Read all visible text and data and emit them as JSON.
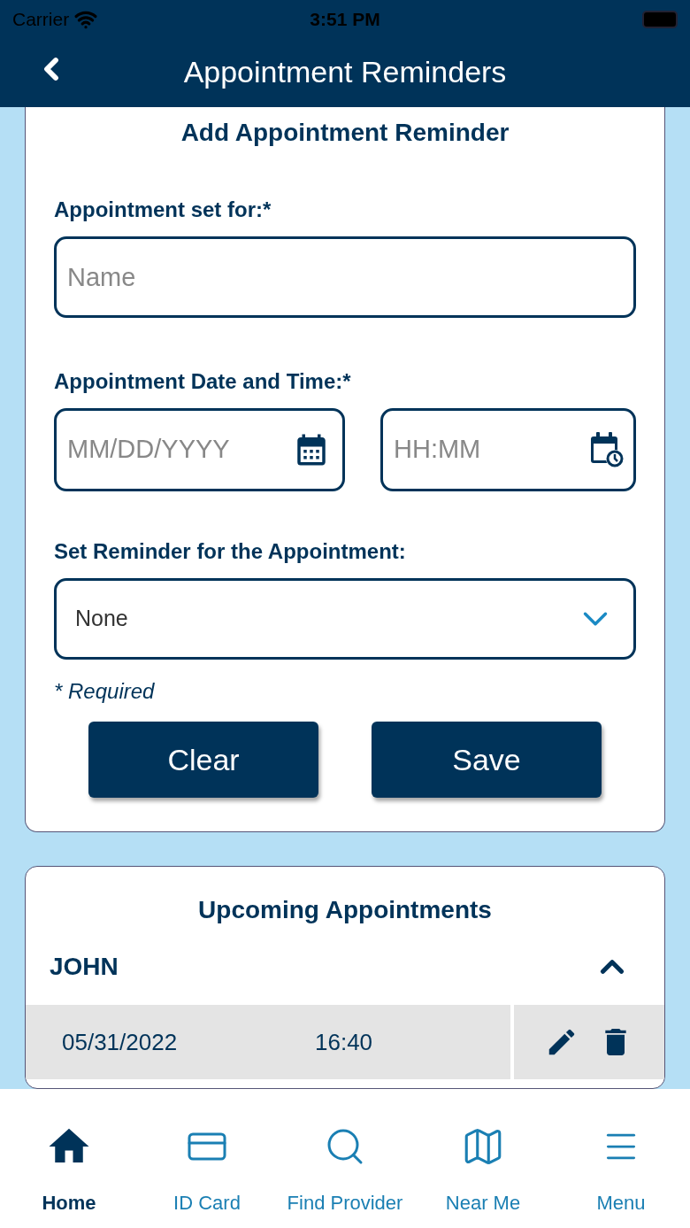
{
  "status_bar": {
    "carrier": "Carrier",
    "time": "3:51 PM"
  },
  "nav": {
    "title": "Appointment Reminders"
  },
  "form": {
    "title": "Add Appointment Reminder",
    "name_label": "Appointment set for:*",
    "name_placeholder": "Name",
    "datetime_label": "Appointment Date and Time:*",
    "date_placeholder": "MM/DD/YYYY",
    "time_placeholder": "HH:MM",
    "reminder_label": "Set Reminder for the Appointment:",
    "reminder_value": "None",
    "required_note": "* Required",
    "buttons": [
      "Clear",
      "Save"
    ]
  },
  "upcoming": {
    "title": "Upcoming Appointments",
    "groups": [
      {
        "name": "JOHN",
        "expanded": true,
        "rows": [
          {
            "date": "05/31/2022",
            "time": "16:40"
          }
        ]
      }
    ]
  },
  "tabs": [
    {
      "label": "Home",
      "selected": true
    },
    {
      "label": "ID Card",
      "selected": false
    },
    {
      "label": "Find Provider",
      "selected": false
    },
    {
      "label": "Near Me",
      "selected": false
    },
    {
      "label": "Menu",
      "selected": false
    }
  ]
}
